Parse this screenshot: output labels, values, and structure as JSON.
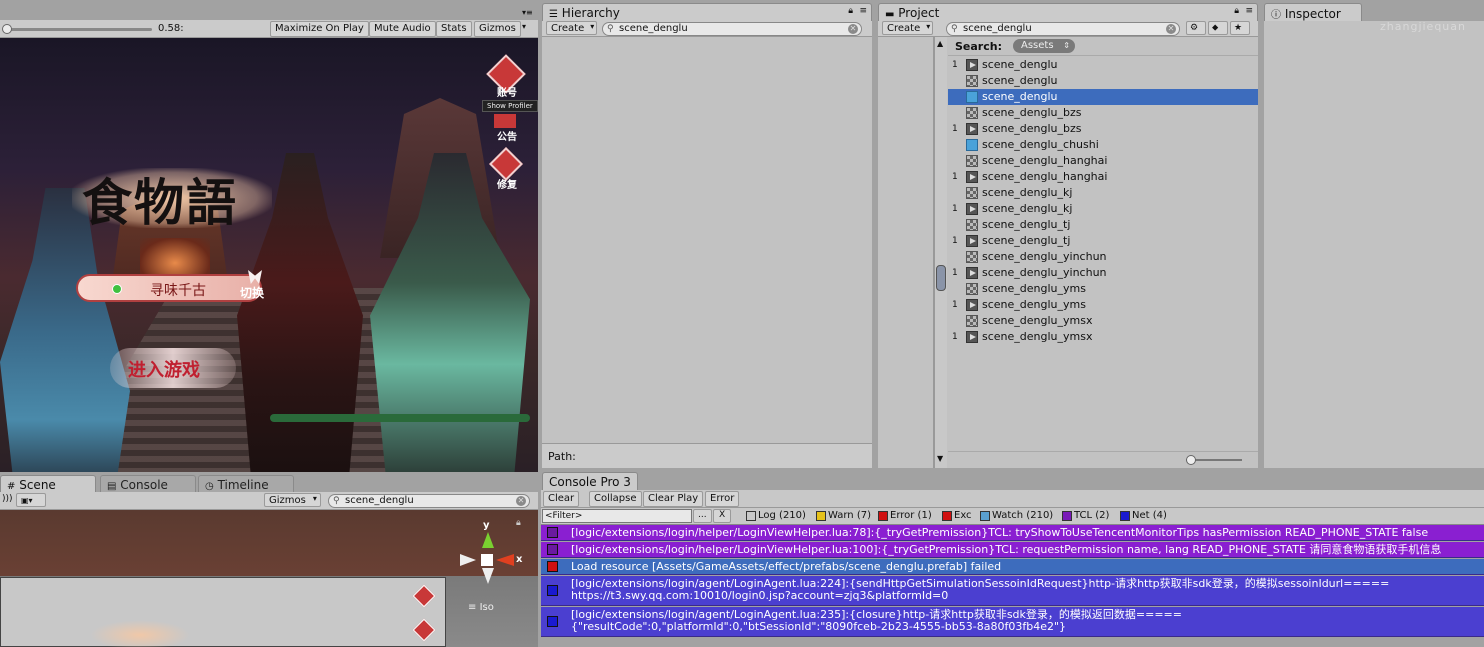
{
  "game": {
    "progress_text": "0.58:",
    "buttons": [
      "Maximize On Play",
      "Mute Audio",
      "Stats",
      "Gizmos"
    ],
    "tooltip": "Show Profiler",
    "side_buttons": [
      "账号",
      "公告",
      "修复"
    ],
    "logo_text": "食物語",
    "server_name": "寻味千古",
    "switch_label": "切换",
    "enter_label": "进入游戏"
  },
  "hierarchy": {
    "tab": "Hierarchy",
    "create": "Create",
    "search": "scene_denglu",
    "path_label": "Path:"
  },
  "project": {
    "tab": "Project",
    "create": "Create",
    "search": "scene_denglu",
    "search_label": "Search:",
    "assets_pill": "Assets",
    "items": [
      {
        "num": "1",
        "icon": "play",
        "name": "scene_denglu"
      },
      {
        "num": "",
        "icon": "scene",
        "name": "scene_denglu"
      },
      {
        "num": "",
        "icon": "prefab",
        "name": "scene_denglu",
        "selected": true
      },
      {
        "num": "",
        "icon": "scene",
        "name": "scene_denglu_bzs"
      },
      {
        "num": "1",
        "icon": "play",
        "name": "scene_denglu_bzs"
      },
      {
        "num": "",
        "icon": "prefab",
        "name": "scene_denglu_chushi"
      },
      {
        "num": "",
        "icon": "scene",
        "name": "scene_denglu_hanghai"
      },
      {
        "num": "1",
        "icon": "play",
        "name": "scene_denglu_hanghai"
      },
      {
        "num": "",
        "icon": "scene",
        "name": "scene_denglu_kj"
      },
      {
        "num": "1",
        "icon": "play",
        "name": "scene_denglu_kj"
      },
      {
        "num": "",
        "icon": "scene",
        "name": "scene_denglu_tj"
      },
      {
        "num": "1",
        "icon": "play",
        "name": "scene_denglu_tj"
      },
      {
        "num": "",
        "icon": "scene",
        "name": "scene_denglu_yinchun"
      },
      {
        "num": "1",
        "icon": "play",
        "name": "scene_denglu_yinchun"
      },
      {
        "num": "",
        "icon": "scene",
        "name": "scene_denglu_yms"
      },
      {
        "num": "1",
        "icon": "play",
        "name": "scene_denglu_yms"
      },
      {
        "num": "",
        "icon": "scene",
        "name": "scene_denglu_ymsx"
      },
      {
        "num": "1",
        "icon": "play",
        "name": "scene_denglu_ymsx"
      }
    ]
  },
  "inspector": {
    "tab": "Inspector",
    "watermark": "zhangjiequan"
  },
  "scene": {
    "tabs": [
      "Scene",
      "Console",
      "Timeline"
    ],
    "gizmos": "Gizmos",
    "search": "scene_denglu",
    "gizmo_y": "y",
    "gizmo_x": "x",
    "iso": "Iso"
  },
  "console": {
    "tab": "Console Pro 3",
    "buttons": [
      "Clear",
      "Collapse",
      "Clear Play",
      "Error"
    ],
    "filter_placeholder": "<Filter>",
    "filter_dots": "...",
    "filter_x": "X",
    "filters": [
      {
        "label": "Log (210)",
        "color": "#c8c8c8"
      },
      {
        "label": "Warn (7)",
        "color": "#e6c21a"
      },
      {
        "label": "Error (1)",
        "color": "#d01010"
      },
      {
        "label": "Exc",
        "color": "#d01010"
      },
      {
        "label": "Watch (210)",
        "color": "#5aa0d0"
      },
      {
        "label": "TCL (2)",
        "color": "#7a1ab8"
      },
      {
        "label": "Net (4)",
        "color": "#1a1ad0"
      }
    ],
    "logs": [
      {
        "bg": "#8a1fd1",
        "sq": "#6a1aa0",
        "lines": [
          "[logic/extensions/login/helper/LoginViewHelper.lua:78]:{_tryGetPremission}TCL: tryShowToUseTencentMonitorTips hasPermission READ_PHONE_STATE false"
        ]
      },
      {
        "bg": "#8a1fd1",
        "sq": "#6a1aa0",
        "lines": [
          "[logic/extensions/login/helper/LoginViewHelper.lua:100]:{_tryGetPremission}TCL: requestPermission name, lang READ_PHONE_STATE 请同意食物语获取手机信息"
        ]
      },
      {
        "bg": "#3d6cbd",
        "sq": "#d01010",
        "lines": [
          "Load resource [Assets/GameAssets/effect/prefabs/scene_denglu.prefab] failed"
        ]
      },
      {
        "bg": "#4b3fd0",
        "sq": "#1a1ad0",
        "lines": [
          "[logic/extensions/login/agent/LoginAgent.lua:224]:{sendHttpGetSimulationSessoinIdRequest}http-请求http获取非sdk登录，的模拟sessoinIdurl=====",
          "https://t3.swy.qq.com:10010/login0.jsp?account=zjq3&platformId=0"
        ]
      },
      {
        "bg": "#4b3fd0",
        "sq": "#1a1ad0",
        "lines": [
          "[logic/extensions/login/agent/LoginAgent.lua:235]:{closure}http-请求http获取非sdk登录，的模拟返回数据=====",
          "{\"resultCode\":0,\"platformId\":0,\"btSessionId\":\"8090fceb-2b23-4555-bb53-8a80f03fb4e2\"}"
        ]
      }
    ]
  }
}
